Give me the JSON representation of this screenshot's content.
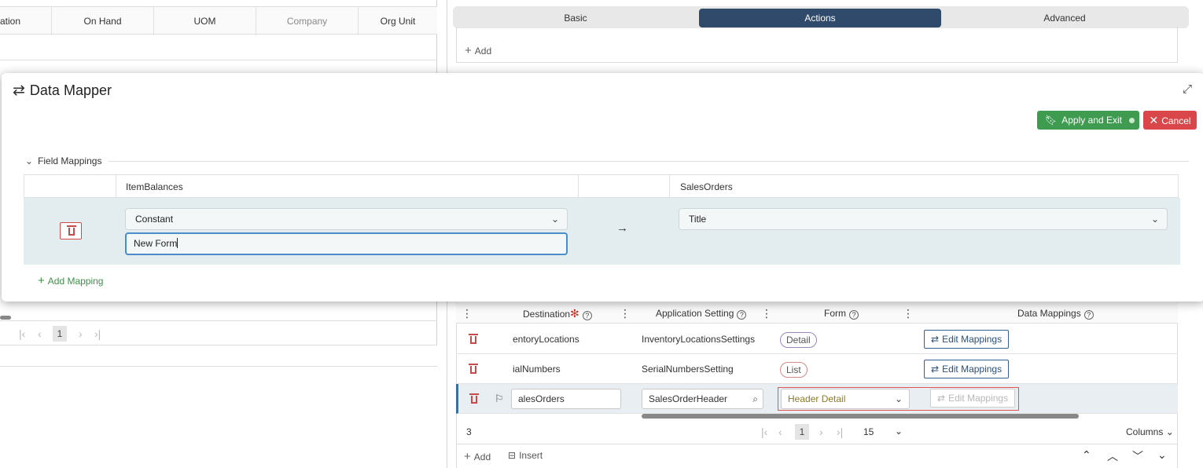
{
  "background_left": {
    "columns": [
      "ation",
      "On Hand",
      "UOM",
      "Company",
      "Org Unit"
    ],
    "pager": {
      "prev_first": "|‹",
      "prev": "‹",
      "page": "1",
      "next": "›",
      "next_last": "›|"
    }
  },
  "tabs": [
    {
      "label": "Basic",
      "active": false
    },
    {
      "label": "Actions",
      "active": true
    },
    {
      "label": "Advanced",
      "active": false
    }
  ],
  "actions_grid": {
    "add_label": "Add"
  },
  "destinations_grid": {
    "headers": {
      "destination": "Destination",
      "application_setting": "Application Setting",
      "form": "Form",
      "data_mappings": "Data Mappings"
    },
    "rows": [
      {
        "destination": "entoryLocations",
        "application_setting": "InventoryLocationsSettings",
        "form": "Detail",
        "mappings_label": "Edit Mappings"
      },
      {
        "destination": "ialNumbers",
        "application_setting": "SerialNumbersSetting",
        "form": "List",
        "mappings_label": "Edit Mappings"
      },
      {
        "destination": "alesOrders",
        "application_setting": "SalesOrderHeader",
        "form": "Header Detail",
        "mappings_label": "Edit Mappings"
      }
    ],
    "footer": {
      "count": "3",
      "page": "1",
      "page_size": "15",
      "columns_label": "Columns"
    },
    "actions": {
      "add_label": "Add",
      "insert_label": "Insert"
    }
  },
  "modal": {
    "title": "Data Mapper",
    "apply_label": "Apply and Exit",
    "cancel_label": "Cancel",
    "section_label": "Field Mappings",
    "source_header": "ItemBalances",
    "destination_header": "SalesOrders",
    "mapping": {
      "source_type": "Constant",
      "source_value": "New Form",
      "destination_field": "Title"
    },
    "add_mapping_label": "Add Mapping"
  },
  "colors": {
    "accent_tab": "#2f4a6a",
    "apply_green": "#3e9b4f",
    "cancel_red": "#d9474a",
    "row_highlight": "#e3edf0",
    "focus_blue": "#4b8dc9"
  }
}
